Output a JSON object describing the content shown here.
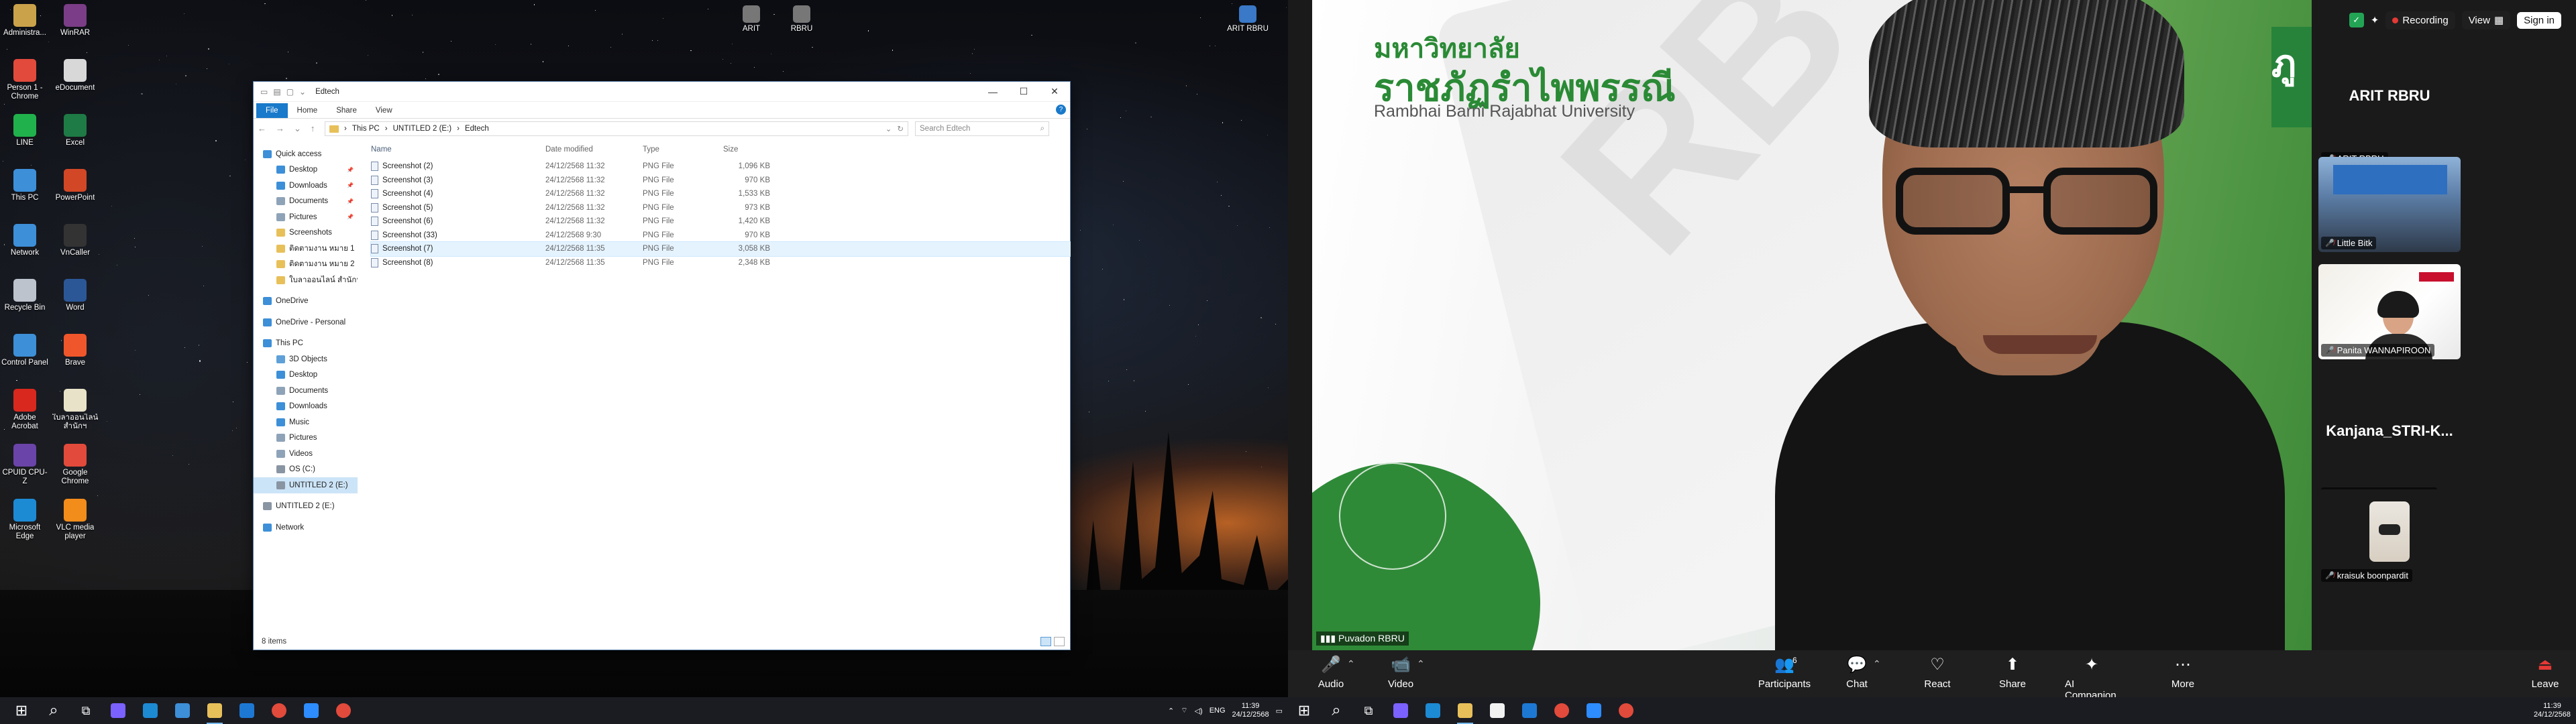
{
  "desktop": {
    "icons": [
      {
        "label": "Administra...",
        "color": "#caa24a",
        "glyph": "doc"
      },
      {
        "label": "WinRAR",
        "color": "#7b3d87",
        "glyph": "rar"
      },
      {
        "label": "Person 1 -\nChrome",
        "color": "#e24a3b",
        "glyph": "chrome"
      },
      {
        "label": "eDocument",
        "color": "#d8d8d8",
        "glyph": "doc"
      },
      {
        "label": "LINE",
        "color": "#21b14c",
        "glyph": "line"
      },
      {
        "label": "Excel",
        "color": "#1e7b45",
        "glyph": "excel"
      },
      {
        "label": "This PC",
        "color": "#3d8fd8",
        "glyph": "pc"
      },
      {
        "label": "PowerPoint",
        "color": "#d24726",
        "glyph": "ppt"
      },
      {
        "label": "Network",
        "color": "#3d8fd8",
        "glyph": "network"
      },
      {
        "label": "VnCaller",
        "color": "#333333",
        "glyph": "vn"
      },
      {
        "label": "Recycle Bin",
        "color": "#bcc3cc",
        "glyph": "bin"
      },
      {
        "label": "Word",
        "color": "#2b5797",
        "glyph": "word"
      },
      {
        "label": "Control Panel",
        "color": "#3d8fd8",
        "glyph": "cp"
      },
      {
        "label": "Brave",
        "color": "#f0562b",
        "glyph": "brave"
      },
      {
        "label": "Adobe\nAcrobat",
        "color": "#d9281d",
        "glyph": "pdf"
      },
      {
        "label": "ใบลาออนไลน์\nสำนักฯ",
        "color": "#e8e2c8",
        "glyph": "doc"
      },
      {
        "label": "CPUID CPU-Z",
        "color": "#6a44a8",
        "glyph": "cpu"
      },
      {
        "label": "Google\nChrome",
        "color": "#e24a3b",
        "glyph": "chrome"
      },
      {
        "label": "Microsoft\nEdge",
        "color": "#1d8ad4",
        "glyph": "edge"
      },
      {
        "label": "VLC media\nplayer",
        "color": "#f28c1a",
        "glyph": "vlc"
      }
    ],
    "top_icons": [
      {
        "label": "ARIT",
        "color": "#777777"
      },
      {
        "label": "RBRU",
        "color": "#777777"
      },
      {
        "label": "ARIT RBRU",
        "color": "#3a78c8"
      }
    ]
  },
  "explorer": {
    "title": "Edtech",
    "ribbon_tabs": [
      "File",
      "Home",
      "Share",
      "View"
    ],
    "help": "?",
    "breadcrumb": [
      "This PC",
      "UNTITLED 2 (E:)",
      "Edtech"
    ],
    "search_placeholder": "Search Edtech",
    "nav_items": [
      {
        "label": "Quick access",
        "color": "#3d8fd8",
        "level": 1,
        "pinned": false
      },
      {
        "label": "Desktop",
        "color": "#3d8fd8",
        "level": 2,
        "pinned": true
      },
      {
        "label": "Downloads",
        "color": "#3d8fd8",
        "level": 2,
        "pinned": true
      },
      {
        "label": "Documents",
        "color": "#8fa3b8",
        "level": 2,
        "pinned": true
      },
      {
        "label": "Pictures",
        "color": "#8fa3b8",
        "level": 2,
        "pinned": true
      },
      {
        "label": "Screenshots",
        "color": "#e8c05a",
        "level": 2,
        "pinned": false
      },
      {
        "label": "ติดตามงาน หมาย 1",
        "color": "#e8c05a",
        "level": 2,
        "pinned": false
      },
      {
        "label": "ติดตามงาน หมาย 2",
        "color": "#e8c05a",
        "level": 2,
        "pinned": false
      },
      {
        "label": "ใบลาออนไลน์ สำนักฯ",
        "color": "#e8c05a",
        "level": 2,
        "pinned": false
      },
      {
        "label": "OneDrive",
        "color": "#3d8fd8",
        "level": 1,
        "pinned": false,
        "gap": true
      },
      {
        "label": "OneDrive - Personal",
        "color": "#3d8fd8",
        "level": 1,
        "pinned": false,
        "gap": true
      },
      {
        "label": "This PC",
        "color": "#3d8fd8",
        "level": 1,
        "pinned": false,
        "gap": true
      },
      {
        "label": "3D Objects",
        "color": "#5fa0d8",
        "level": 2,
        "pinned": false
      },
      {
        "label": "Desktop",
        "color": "#3d8fd8",
        "level": 2,
        "pinned": false
      },
      {
        "label": "Documents",
        "color": "#8fa3b8",
        "level": 2,
        "pinned": false
      },
      {
        "label": "Downloads",
        "color": "#3d8fd8",
        "level": 2,
        "pinned": false
      },
      {
        "label": "Music",
        "color": "#3d8fd8",
        "level": 2,
        "pinned": false
      },
      {
        "label": "Pictures",
        "color": "#8fa3b8",
        "level": 2,
        "pinned": false
      },
      {
        "label": "Videos",
        "color": "#8fa3b8",
        "level": 2,
        "pinned": false
      },
      {
        "label": "OS (C:)",
        "color": "#8a95a3",
        "level": 2,
        "pinned": false
      },
      {
        "label": "UNTITLED 2 (E:)",
        "color": "#8a95a3",
        "level": 2,
        "pinned": false,
        "selected": true
      },
      {
        "label": "UNTITLED 2 (E:)",
        "color": "#8a95a3",
        "level": 1,
        "pinned": false,
        "gap": true
      },
      {
        "label": "Network",
        "color": "#3d8fd8",
        "level": 1,
        "pinned": false,
        "gap": true
      }
    ],
    "columns": [
      "Name",
      "Date modified",
      "Type",
      "Size"
    ],
    "rows": [
      {
        "name": "Screenshot (2)",
        "date": "24/12/2568 11:32",
        "type": "PNG File",
        "size": "1,096 KB"
      },
      {
        "name": "Screenshot (3)",
        "date": "24/12/2568 11:32",
        "type": "PNG File",
        "size": "970 KB"
      },
      {
        "name": "Screenshot (4)",
        "date": "24/12/2568 11:32",
        "type": "PNG File",
        "size": "1,533 KB"
      },
      {
        "name": "Screenshot (5)",
        "date": "24/12/2568 11:32",
        "type": "PNG File",
        "size": "973 KB"
      },
      {
        "name": "Screenshot (6)",
        "date": "24/12/2568 11:32",
        "type": "PNG File",
        "size": "1,420 KB"
      },
      {
        "name": "Screenshot (33)",
        "date": "24/12/2568 9:30",
        "type": "PNG File",
        "size": "970 KB"
      },
      {
        "name": "Screenshot (7)",
        "date": "24/12/2568 11:35",
        "type": "PNG File",
        "size": "3,058 KB",
        "selected": true
      },
      {
        "name": "Screenshot (8)",
        "date": "24/12/2568 11:35",
        "type": "PNG File",
        "size": "2,348 KB"
      }
    ],
    "status": "8 items"
  },
  "taskbar_left": {
    "clock_time": "11:39",
    "clock_date": "24/12/2568",
    "lang": "ENG",
    "apps": [
      {
        "name": "start",
        "color": "#ffffff"
      },
      {
        "name": "search",
        "color": "#ffffff"
      },
      {
        "name": "task-view",
        "color": "#ffffff"
      },
      {
        "name": "copilot",
        "color": "#7b61ff"
      },
      {
        "name": "edge",
        "color": "#1d8ad4"
      },
      {
        "name": "store",
        "color": "#3d8fd8"
      },
      {
        "name": "file-explorer",
        "color": "#e8c05a"
      },
      {
        "name": "mail",
        "color": "#1d78d4"
      },
      {
        "name": "chrome",
        "color": "#e24a3b"
      },
      {
        "name": "zoom",
        "color": "#2d8cff"
      },
      {
        "name": "chrome-2",
        "color": "#e24a3b"
      }
    ]
  },
  "taskbar_right": {
    "clock_time": "11:39",
    "clock_date": "24/12/2568",
    "apps": [
      {
        "name": "start",
        "color": "#ffffff"
      },
      {
        "name": "search",
        "color": "#ffffff"
      },
      {
        "name": "task-view",
        "color": "#ffffff"
      },
      {
        "name": "copilot",
        "color": "#7b61ff"
      },
      {
        "name": "edge",
        "color": "#1d8ad4"
      },
      {
        "name": "file-explorer",
        "color": "#e8c05a"
      },
      {
        "name": "calendar",
        "color": "#f2f2f2"
      },
      {
        "name": "mail",
        "color": "#1d78d4"
      },
      {
        "name": "chrome",
        "color": "#e24a3b"
      },
      {
        "name": "zoom",
        "color": "#2d8cff"
      },
      {
        "name": "chrome-2",
        "color": "#e24a3b"
      }
    ]
  },
  "zoom": {
    "recording_label": "Recording",
    "view_label": "View",
    "signin_label": "Sign in",
    "speaker_name": "Puvadon RBRU",
    "slide": {
      "university_thai_1": "มหาวิทยาลัย",
      "university_thai_2": "ราชภัฏรำไพพรรณี",
      "university_en": "Rambhai Barni Rajabhat University",
      "rb_watermark": "RB",
      "banner_text": "ภู"
    },
    "gallery": [
      {
        "name": "ARIT RBRU",
        "label": "ARIT RBRU",
        "kind": "name"
      },
      {
        "name": "",
        "label": "Little Bitk",
        "kind": "video-room"
      },
      {
        "name": "",
        "label": "Panita WANNAPIROON",
        "kind": "video-woman"
      },
      {
        "name": "Kanjana_STRI-K...",
        "label": "Kanjana_STRI-KMUTNB",
        "kind": "name"
      },
      {
        "name": "",
        "label": "kraisuk boonpardit",
        "kind": "avatar"
      }
    ],
    "controls": [
      {
        "label": "Audio",
        "icon": "mic-off-icon",
        "glyph": "🎤",
        "muted": true
      },
      {
        "label": "Video",
        "icon": "video-off-icon",
        "glyph": "📹",
        "muted": true
      },
      {
        "label": "Participants",
        "icon": "participants-icon",
        "glyph": "👥",
        "badge": "6"
      },
      {
        "label": "Chat",
        "icon": "chat-icon",
        "glyph": "💬"
      },
      {
        "label": "React",
        "icon": "react-icon",
        "glyph": "♡"
      },
      {
        "label": "Share",
        "icon": "share-icon",
        "glyph": "⬆"
      },
      {
        "label": "AI Companion",
        "icon": "ai-companion-icon",
        "glyph": "✦"
      },
      {
        "label": "More",
        "icon": "more-icon",
        "glyph": "⋯"
      },
      {
        "label": "Leave",
        "icon": "leave-icon",
        "glyph": "⏏",
        "danger": true
      }
    ]
  }
}
